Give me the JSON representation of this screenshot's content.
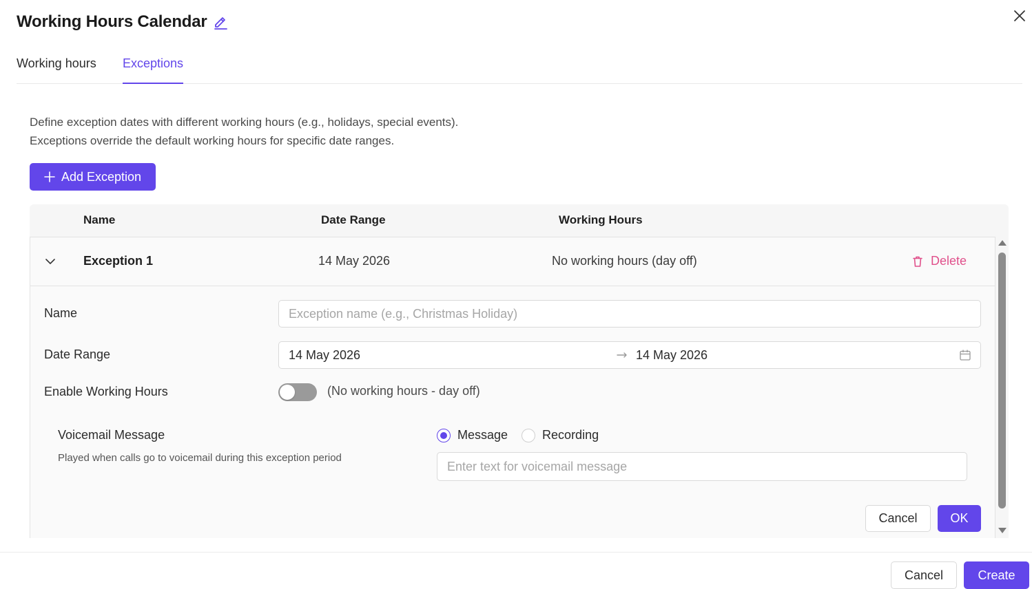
{
  "dialog": {
    "title": "Working Hours Calendar"
  },
  "tabs": [
    {
      "label": "Working hours",
      "active": false
    },
    {
      "label": "Exceptions",
      "active": true
    }
  ],
  "description": {
    "line1": "Define exception dates with different working hours (e.g., holidays, special events).",
    "line2": "Exceptions override the default working hours for specific date ranges."
  },
  "add_button": {
    "label": "Add Exception"
  },
  "table": {
    "columns": [
      "Name",
      "Date Range",
      "Working Hours"
    ],
    "rows": [
      {
        "name": "Exception 1",
        "date_range": "14 May 2026",
        "working_hours": "No working hours (day off)",
        "delete_label": "Delete",
        "expanded": true
      }
    ]
  },
  "exception_form": {
    "name_label": "Name",
    "name_placeholder": "Exception name (e.g., Christmas Holiday)",
    "name_value": "",
    "date_range_label": "Date Range",
    "start_date": "14 May 2026",
    "end_date": "14 May 2026",
    "enable_label": "Enable Working Hours",
    "enable_on": false,
    "toggle_note": "(No working hours - day off)",
    "voicemail_title": "Voicemail Message",
    "voicemail_subtitle": "Played when calls go to voicemail during this exception period",
    "radio_options": [
      {
        "label": "Message",
        "checked": true
      },
      {
        "label": "Recording",
        "checked": false
      }
    ],
    "voicemail_placeholder": "Enter text for voicemail message",
    "cancel_label": "Cancel",
    "ok_label": "OK"
  },
  "footer": {
    "cancel_label": "Cancel",
    "create_label": "Create"
  },
  "colors": {
    "accent": "#6246ea",
    "danger": "#e0508b",
    "toggle_off": "#9a9a9a"
  },
  "icons": [
    "edit-pencil-icon",
    "close-icon",
    "plus-icon",
    "chevron-down-icon",
    "trash-icon",
    "arrow-right-icon",
    "calendar-icon"
  ]
}
